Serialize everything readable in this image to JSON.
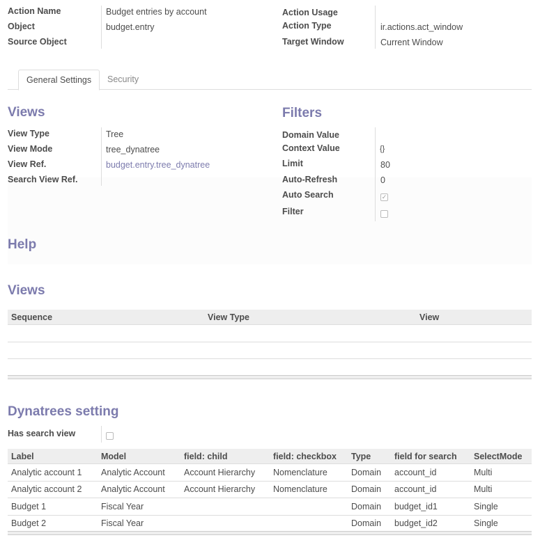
{
  "header": {
    "left": [
      {
        "label": "Action Name",
        "value": "Budget entries by account"
      },
      {
        "label": "Object",
        "value": "budget.entry"
      },
      {
        "label": "Source Object",
        "value": ""
      }
    ],
    "right": [
      {
        "label": "Action Usage",
        "value": ""
      },
      {
        "label": "Action Type",
        "value": "ir.actions.act_window"
      },
      {
        "label": "Target Window",
        "value": "Current Window"
      }
    ]
  },
  "tabs": [
    {
      "label": "General Settings",
      "active": true
    },
    {
      "label": "Security",
      "active": false
    }
  ],
  "views_section": {
    "title": "Views",
    "fields": [
      {
        "label": "View Type",
        "value": "Tree"
      },
      {
        "label": "View Mode",
        "value": "tree_dynatree"
      },
      {
        "label": "View Ref.",
        "value": "budget.entry.tree_dynatree"
      },
      {
        "label": "Search View Ref.",
        "value": ""
      }
    ]
  },
  "filters_section": {
    "title": "Filters",
    "fields": [
      {
        "label": "Domain Value",
        "value": ""
      },
      {
        "label": "Context Value",
        "value": "{}"
      },
      {
        "label": "Limit",
        "value": "80"
      },
      {
        "label": "Auto-Refresh",
        "value": "0"
      },
      {
        "label": "Auto Search",
        "checked": true
      },
      {
        "label": "Filter",
        "checked": false
      }
    ]
  },
  "help": {
    "title": "Help"
  },
  "views_table": {
    "title": "Views",
    "columns": [
      "Sequence",
      "View Type",
      "View"
    ],
    "rows": []
  },
  "dynatrees": {
    "title": "Dynatrees setting",
    "has_search_view_label": "Has search view",
    "has_search_view": false,
    "columns": [
      "Label",
      "Model",
      "field: child",
      "field: checkbox",
      "Type",
      "field for search",
      "SelectMode"
    ],
    "rows": [
      [
        "Analytic account 1",
        "Analytic Account",
        "Account Hierarchy",
        "Nomenclature",
        "Domain",
        "account_id",
        "Multi"
      ],
      [
        "Analytic account 2",
        "Analytic Account",
        "Account Hierarchy",
        "Nomenclature",
        "Domain",
        "account_id",
        "Multi"
      ],
      [
        "Budget 1",
        "Fiscal Year",
        "",
        "",
        "Domain",
        "budget_id1",
        "Single"
      ],
      [
        "Budget 2",
        "Fiscal Year",
        "",
        "",
        "Domain",
        "budget_id2",
        "Single"
      ]
    ]
  },
  "colors": {
    "heading": "#7c7bad",
    "link": "#7c7bad"
  }
}
